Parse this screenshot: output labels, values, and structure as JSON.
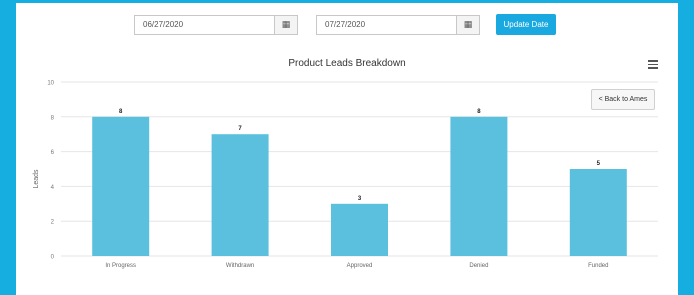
{
  "filters": {
    "start_date": "06/27/2020",
    "end_date": "07/27/2020",
    "calendar_icon": "calendar-icon",
    "update_label": "Update Date"
  },
  "chart_menu_icon": "hamburger-menu-icon",
  "back_button_label": "< Back to Ames",
  "colors": {
    "bar": "#5bc0de",
    "page_border": "#16aee0",
    "button": "#1aa8e0"
  },
  "chart_data": {
    "type": "bar",
    "title": "Product Leads Breakdown",
    "xlabel": "",
    "ylabel": "Leads",
    "categories": [
      "In Progress",
      "Withdrawn",
      "Approved",
      "Denied",
      "Funded"
    ],
    "values": [
      8,
      7,
      3,
      8,
      5
    ],
    "ylim": [
      0,
      10
    ],
    "yticks": [
      0,
      2,
      4,
      6,
      8,
      10
    ],
    "grid": true,
    "data_labels": true
  }
}
